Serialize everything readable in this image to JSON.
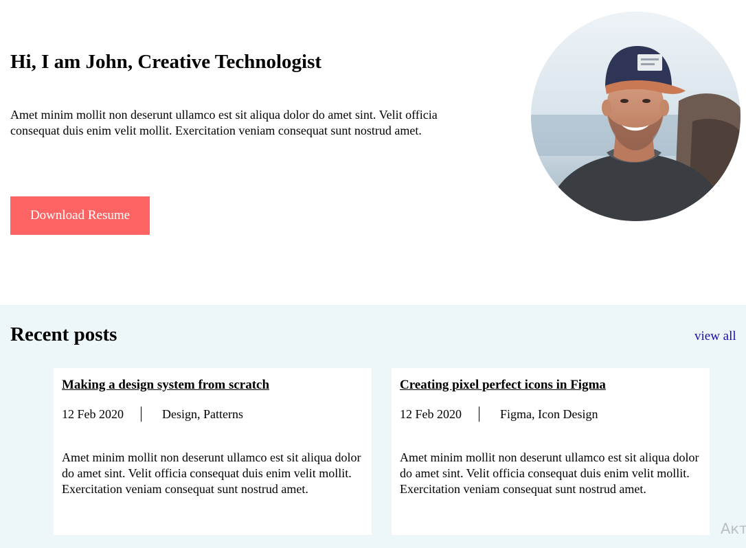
{
  "hero": {
    "title": "Hi, I am John, Creative Technologist",
    "description": "Amet minim mollit non deserunt ullamco est sit aliqua dolor do amet sint. Velit officia consequat duis enim velit mollit. Exercitation veniam consequat sunt nostrud amet.",
    "button_label": "Download Resume",
    "button_color": "#ff6464"
  },
  "recent_posts": {
    "title": "Recent posts",
    "view_all_label": "view all",
    "background": "#edf7fa",
    "posts": [
      {
        "title": "Making a design system from scratch",
        "date": "12 Feb 2020",
        "tags": "Design, Patterns",
        "excerpt": "Amet minim mollit non deserunt ullamco est sit aliqua dolor do amet sint. Velit officia consequat duis enim velit mollit. Exercitation veniam consequat sunt nostrud amet."
      },
      {
        "title": "Creating pixel perfect icons in Figma",
        "date": "12 Feb 2020",
        "tags": "Figma, Icon Design",
        "excerpt": "Amet minim mollit non deserunt ullamco est sit aliqua dolor do amet sint. Velit officia consequat duis enim velit mollit. Exercitation veniam consequat sunt nostrud amet."
      }
    ]
  },
  "watermark": {
    "text": "Акт"
  }
}
